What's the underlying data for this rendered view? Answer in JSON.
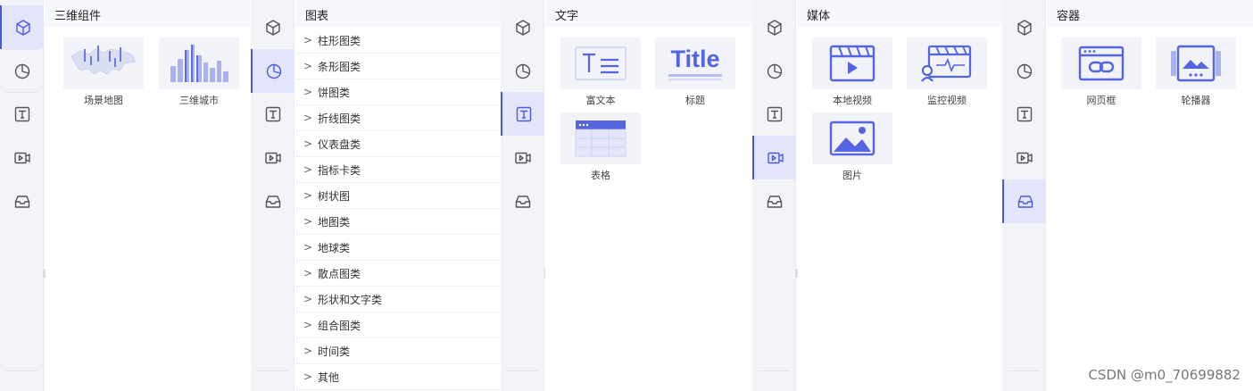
{
  "panels": {
    "p1": {
      "title": "三维组件",
      "items": [
        {
          "label": "场景地图",
          "icon": "scene-map-thumb"
        },
        {
          "label": "三维城市",
          "icon": "3d-city-thumb"
        }
      ]
    },
    "p2": {
      "title": "图表",
      "categories": [
        "柱形图类",
        "条形图类",
        "饼图类",
        "折线图类",
        "仪表盘类",
        "指标卡类",
        "树状图",
        "地图类",
        "地球类",
        "散点图类",
        "形状和文字类",
        "组合图类",
        "时间类",
        "其他"
      ]
    },
    "p3": {
      "title": "文字",
      "items": [
        {
          "label": "富文本",
          "icon": "rich-text-thumb"
        },
        {
          "label": "标题",
          "icon": "title-thumb",
          "thumb_text": "Title"
        },
        {
          "label": "表格",
          "icon": "table-thumb"
        }
      ]
    },
    "p4": {
      "title": "媒体",
      "items": [
        {
          "label": "本地视频",
          "icon": "local-video-thumb"
        },
        {
          "label": "监控视频",
          "icon": "monitor-video-thumb"
        },
        {
          "label": "图片",
          "icon": "image-thumb"
        }
      ]
    },
    "p5": {
      "title": "容器",
      "items": [
        {
          "label": "网页框",
          "icon": "webpage-frame-thumb"
        },
        {
          "label": "轮播器",
          "icon": "carousel-thumb"
        }
      ]
    }
  },
  "rail_icons": [
    "3d-cube-icon",
    "chart-pie-icon",
    "text-icon",
    "media-icon",
    "container-icon"
  ],
  "watermark": "CSDN @m0_70699882",
  "colors": {
    "accent": "#4a5ae0",
    "rail_bg": "#f3f4f8",
    "active_bg": "#e3e6fa"
  }
}
